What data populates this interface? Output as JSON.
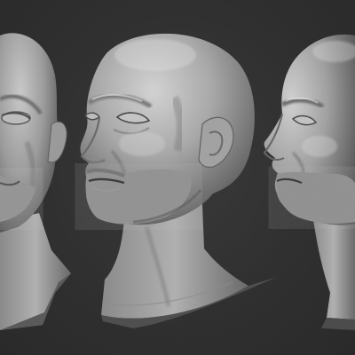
{
  "scene": {
    "background_color": "#2f2f2f",
    "material_color": "#a9a9a9",
    "subject": "bald-male-head-sculpt",
    "views": [
      {
        "id": "left-crop",
        "angle": "three-quarter-left-cropped"
      },
      {
        "id": "center",
        "angle": "three-quarter-left"
      },
      {
        "id": "right-crop",
        "angle": "profile-left-cropped"
      }
    ]
  }
}
